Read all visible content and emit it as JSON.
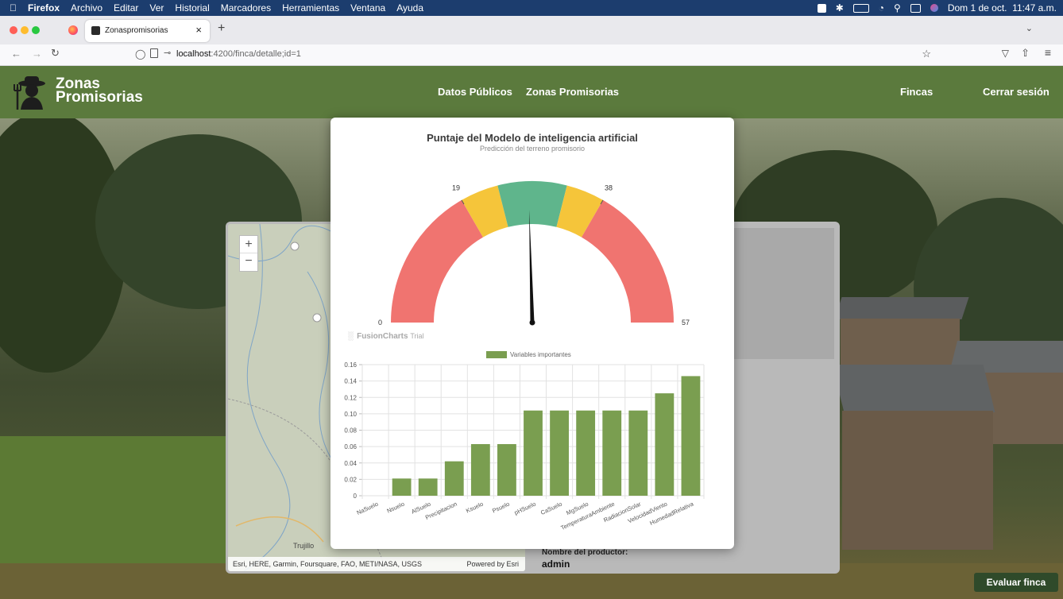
{
  "menubar": {
    "app_name": "Firefox",
    "items": [
      "Archivo",
      "Editar",
      "Ver",
      "Historial",
      "Marcadores",
      "Herramientas",
      "Ventana",
      "Ayuda"
    ],
    "datetime": "Dom 1 de oct.  11:47 a.m."
  },
  "browser": {
    "tab_title": "Zonaspromisorias",
    "url_host": "localhost",
    "url_rest": ":4200/finca/detalle;id=1"
  },
  "site": {
    "brand_line1": "Zonas",
    "brand_line2": "Promisorias",
    "nav_datos": "Datos Públicos",
    "nav_zonas": "Zonas Promisorias",
    "nav_fincas": "Fincas",
    "nav_logout": "Cerrar sesión"
  },
  "map": {
    "attribution": "Esri, HERE, Garmin, Foursquare, FAO, METI/NASA, USGS",
    "powered": "Powered by Esri",
    "city_label": "Trujillo"
  },
  "details": {
    "producer_label": "Nombre del productor:",
    "producer_value": "admin"
  },
  "gauge": {
    "title": "Puntaje del Modelo de inteligencia artificial",
    "subtitle": "Predicción del terreno promisorio",
    "min": 0,
    "max": 57,
    "ticks": [
      19,
      38
    ],
    "value": 28,
    "bands": [
      {
        "from": 0,
        "to": 19,
        "color": "#f07470"
      },
      {
        "from": 19,
        "to": 24,
        "color": "#f5c53a"
      },
      {
        "from": 24,
        "to": 33,
        "color": "#5fb58c"
      },
      {
        "from": 33,
        "to": 38,
        "color": "#f5c53a"
      },
      {
        "from": 38,
        "to": 57,
        "color": "#f07470"
      }
    ],
    "watermark": "FusionCharts",
    "watermark_suffix": "Trial"
  },
  "chart_data": {
    "type": "bar",
    "legend": "Variables importantes",
    "categories": [
      "NaSuelo",
      "Nsuelo",
      "AlSuelo",
      "Precipitacion",
      "Ksuelo",
      "Psuelo",
      "pHSuelo",
      "CaSuelo",
      "MgSuelo",
      "TemperaturaAmbiente",
      "RadiacionSolar",
      "VelocidadViento",
      "HumedadRelativa"
    ],
    "values": [
      0,
      0.021,
      0.021,
      0.042,
      0.063,
      0.063,
      0.104,
      0.104,
      0.104,
      0.104,
      0.104,
      0.125,
      0.146
    ],
    "ylim": [
      0,
      0.16
    ],
    "yticks": [
      "0",
      "0.02",
      "0.04",
      "0.06",
      "0.08",
      "0.10",
      "0.12",
      "0.14",
      "0.16"
    ],
    "color": "#7a9e50",
    "grid": true,
    "legend_position": "top"
  },
  "button_evaluar": "Evaluar finca"
}
